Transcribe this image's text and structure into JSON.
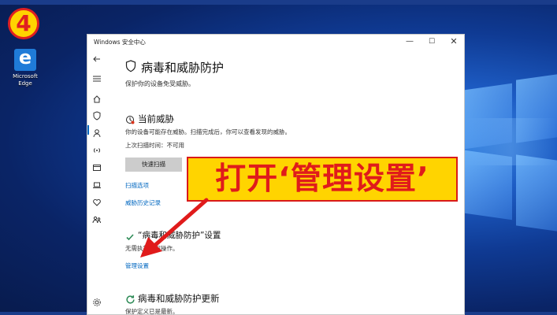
{
  "step": {
    "number": "4"
  },
  "desktop": {
    "icon_label_line1": "Microsoft",
    "icon_label_line2": "Edge"
  },
  "window": {
    "title": "Windows 安全中心",
    "controls": {
      "minimize": "—",
      "maximize": "☐",
      "close": "✕"
    }
  },
  "page": {
    "title": "病毒和威胁防护",
    "subtitle": "保护你的设备免受威胁。"
  },
  "current_threats": {
    "heading": "当前威胁",
    "description": "你的设备可能存在威胁。扫描完成后，你可以查看发现的威胁。",
    "last_scan": "上次扫描时间：不可用",
    "quick_scan_label": "快速扫描",
    "scan_options_link": "扫描选项",
    "history_link": "威胁历史记录"
  },
  "settings_section": {
    "heading": "“病毒和威胁防护”设置",
    "description": "无需执行任何操作。",
    "manage_link": "管理设置"
  },
  "updates_section": {
    "heading": "病毒和威胁防护更新",
    "description": "保护定义已是最新。"
  },
  "callout": {
    "text": "打开‘管理设置’"
  },
  "colors": {
    "accent": "#0067c0",
    "callout_bg": "#ffd400",
    "callout_text": "#e01b1b",
    "check_green": "#2e8b57"
  }
}
